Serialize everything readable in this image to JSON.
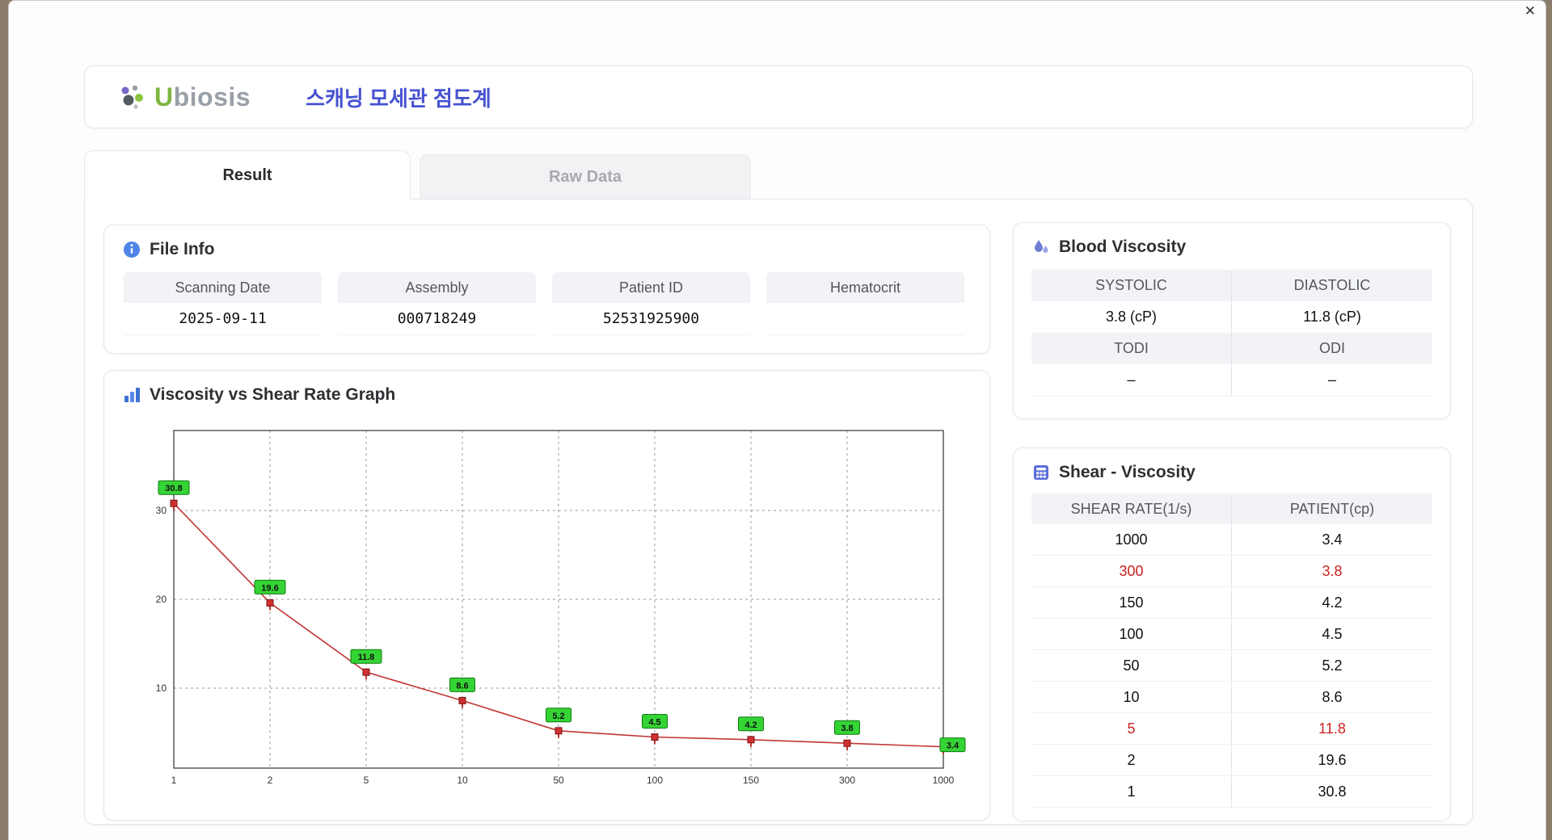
{
  "window": {
    "close_glyph": "✕"
  },
  "header": {
    "logo_u": "U",
    "logo_rest": "biosis",
    "app_title": "스캐닝 모세관 점도계"
  },
  "tabs": [
    {
      "label": "Result",
      "active": true
    },
    {
      "label": "Raw Data",
      "active": false
    }
  ],
  "file_info": {
    "title": "File Info",
    "fields": [
      {
        "label": "Scanning Date",
        "value": "2025-09-11"
      },
      {
        "label": "Assembly",
        "value": "000718249"
      },
      {
        "label": "Patient ID",
        "value": "52531925900"
      },
      {
        "label": "Hematocrit",
        "value": ""
      }
    ]
  },
  "graph": {
    "title": "Viscosity vs Shear Rate Graph"
  },
  "chart_data": {
    "type": "line",
    "title": "Viscosity vs Shear Rate Graph",
    "x": [
      1,
      2,
      5,
      10,
      50,
      100,
      150,
      300,
      1000
    ],
    "values": [
      30.8,
      19.6,
      11.8,
      8.6,
      5.2,
      4.5,
      4.2,
      3.8,
      3.4
    ],
    "xlabel": "",
    "ylabel": "",
    "yticks": [
      10,
      20,
      30
    ],
    "ylim": [
      1,
      39
    ],
    "grid": "dashed",
    "line_color": "#c23434",
    "marker_color": "#d03030",
    "label_bg": "#35d435"
  },
  "blood_viscosity": {
    "title": "Blood Viscosity",
    "cells": [
      {
        "label": "SYSTOLIC",
        "value": "3.8 (cP)"
      },
      {
        "label": "DIASTOLIC",
        "value": "11.8 (cP)"
      },
      {
        "label": "TODI",
        "value": "–"
      },
      {
        "label": "ODI",
        "value": "–"
      }
    ]
  },
  "shear_viscosity": {
    "title": "Shear - Viscosity",
    "columns": [
      "SHEAR RATE(1/s)",
      "PATIENT(cp)"
    ],
    "rows": [
      {
        "shear": "1000",
        "patient": "3.4"
      },
      {
        "shear": "300",
        "patient": "3.8"
      },
      {
        "shear": "150",
        "patient": "4.2"
      },
      {
        "shear": "100",
        "patient": "4.5"
      },
      {
        "shear": "50",
        "patient": "5.2"
      },
      {
        "shear": "10",
        "patient": "8.6"
      },
      {
        "shear": "5",
        "patient": "11.8"
      },
      {
        "shear": "2",
        "patient": "19.6"
      },
      {
        "shear": "1",
        "patient": "30.8"
      }
    ]
  }
}
